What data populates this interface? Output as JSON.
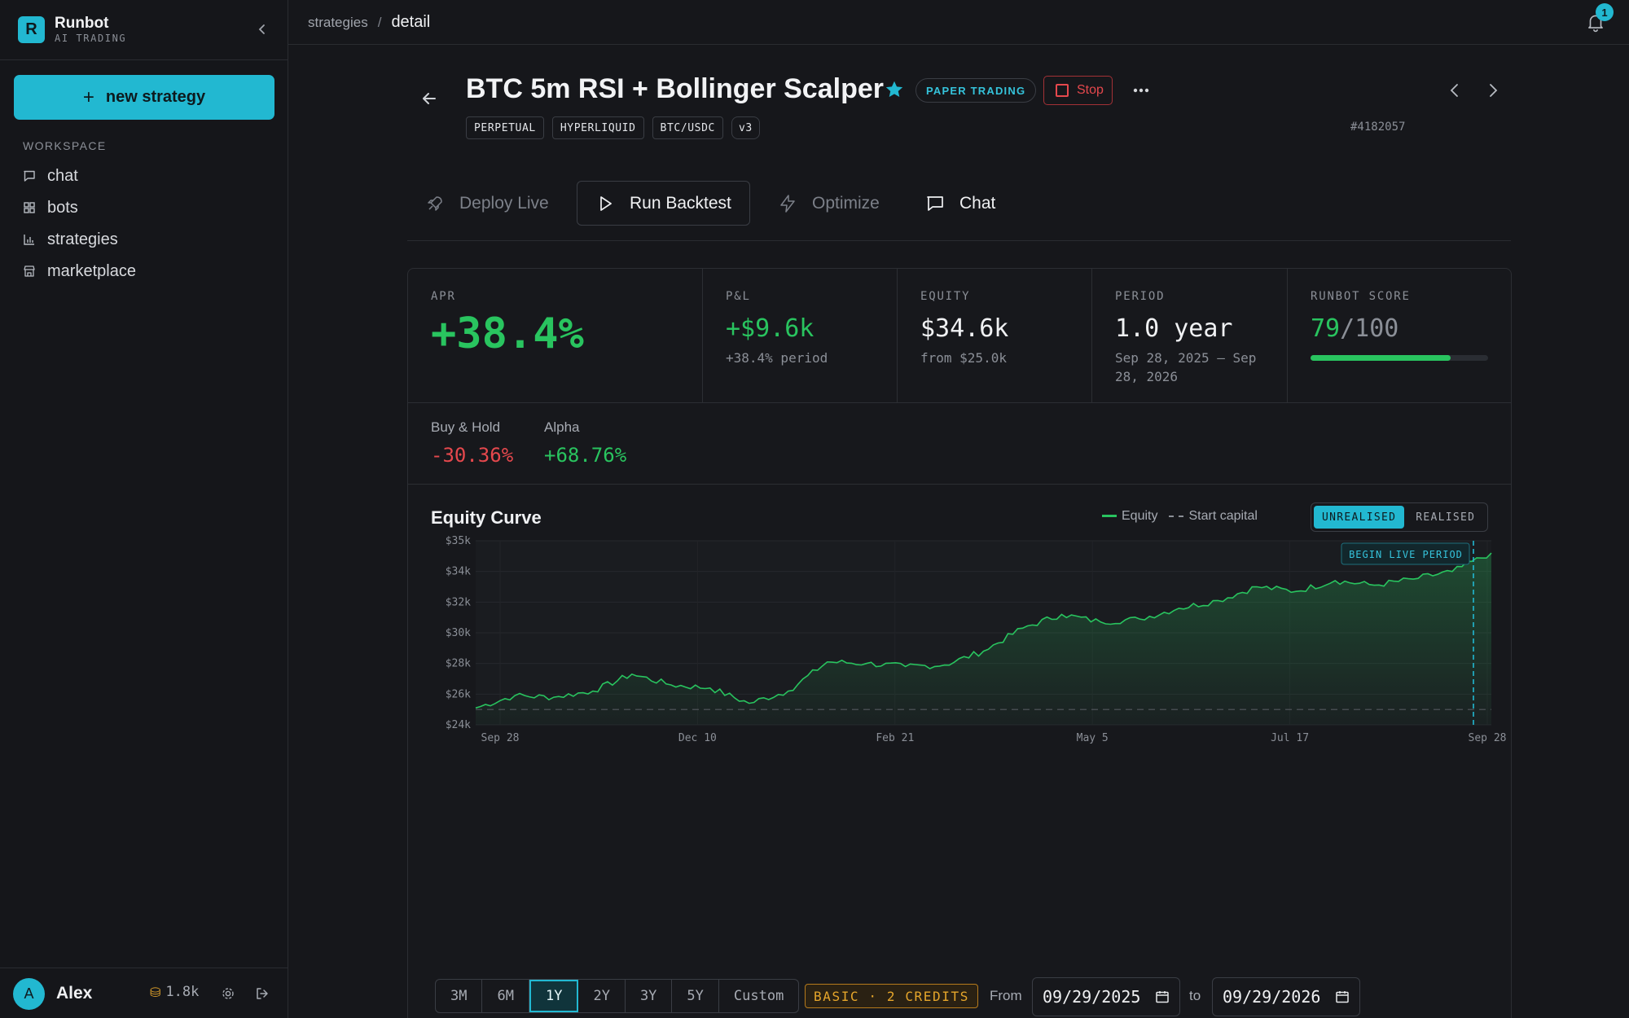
{
  "sidebar": {
    "brand_logo": "R",
    "brand_name": "Runbot",
    "brand_sub": "AI TRADING",
    "new_strategy_label": "new strategy",
    "workspace_label": "WORKSPACE",
    "items": [
      {
        "label": "chat",
        "icon": "message-square-icon"
      },
      {
        "label": "bots",
        "icon": "grid-icon"
      },
      {
        "label": "strategies",
        "icon": "bar-chart-icon"
      },
      {
        "label": "marketplace",
        "icon": "store-icon"
      }
    ],
    "user": {
      "initial": "A",
      "name": "Alex",
      "credits": "1.8k"
    }
  },
  "topbar": {
    "breadcrumb_parent": "strategies",
    "breadcrumb_sep": "/",
    "breadcrumb_current": "detail",
    "notification_count": "1"
  },
  "header": {
    "title": "BTC 5m RSI + Bollinger Scalper",
    "mode_badge": "PAPER TRADING",
    "stop_label": "Stop",
    "tags": [
      "PERPETUAL",
      "HYPERLIQUID",
      "BTC/USDC",
      "v3"
    ],
    "strategy_id": "#4182057"
  },
  "actions": {
    "deploy": "Deploy Live",
    "backtest": "Run Backtest",
    "optimize": "Optimize",
    "chat": "Chat"
  },
  "stats": {
    "apr": {
      "label": "APR",
      "value": "+38.4%"
    },
    "pnl": {
      "label": "P&L",
      "value": "+$9.6k",
      "sub": "+38.4% period"
    },
    "equity": {
      "label": "EQUITY",
      "value": "$34.6k",
      "sub": "from $25.0k"
    },
    "period": {
      "label": "PERIOD",
      "value": "1.0 year",
      "sub": "Sep 28, 2025 – Sep 28, 2026"
    },
    "score": {
      "label": "RUNBOT SCORE",
      "value": "79",
      "max": "/100",
      "fraction": 0.79
    },
    "buy_hold": {
      "label": "Buy & Hold",
      "value": "-30.36%"
    },
    "alpha": {
      "label": "Alpha",
      "value": "+68.76%"
    }
  },
  "chart": {
    "title": "Equity Curve",
    "legend_equity": "Equity",
    "legend_start": "Start capital",
    "toggle": [
      "UNREALISED",
      "REALISED"
    ],
    "toggle_active": "UNREALISED",
    "live_label": "BEGIN LIVE PERIOD"
  },
  "chart_data": {
    "type": "area",
    "title": "Equity Curve",
    "xlabel": "",
    "ylabel": "",
    "x_ticks": [
      "Sep 28",
      "Dec 10",
      "Feb 21",
      "May 5",
      "Jul 17",
      "Sep 28"
    ],
    "y_ticks": [
      "$35k",
      "$34k",
      "$32k",
      "$30k",
      "$28k",
      "$26k",
      "$24k"
    ],
    "ylim": [
      24000,
      36000
    ],
    "start_capital": 25000,
    "live_period_start": "Sep 2026",
    "series": [
      {
        "name": "Equity",
        "color": "#29c45f",
        "x": [
          "Sep 28",
          "Oct 11",
          "Oct 25",
          "Nov 8",
          "Nov 22",
          "Dec 6",
          "Dec 20",
          "Jan 3",
          "Jan 17",
          "Jan 31",
          "Feb 14",
          "Feb 28",
          "Mar 14",
          "Mar 28",
          "Apr 11",
          "Apr 25",
          "May 9",
          "May 23",
          "Jun 6",
          "Jun 20",
          "Jul 4",
          "Jul 18",
          "Aug 1",
          "Aug 15",
          "Aug 29",
          "Sep 12",
          "Sep 28"
        ],
        "values": [
          25100,
          25900,
          25800,
          26200,
          27300,
          26600,
          26400,
          25400,
          26200,
          28100,
          28000,
          27800,
          27900,
          28800,
          30300,
          31200,
          30700,
          30900,
          31600,
          32100,
          33000,
          32700,
          33400,
          33100,
          33500,
          34000,
          35200
        ]
      }
    ]
  },
  "controls": {
    "ranges": [
      "3M",
      "6M",
      "1Y",
      "2Y",
      "3Y",
      "5Y",
      "Custom"
    ],
    "active_range": "1Y",
    "plan_badge": "BASIC · 2 CREDITS",
    "from_label": "From",
    "from_value": "09/29/2025",
    "to_label": "to",
    "to_value": "09/29/2026"
  }
}
